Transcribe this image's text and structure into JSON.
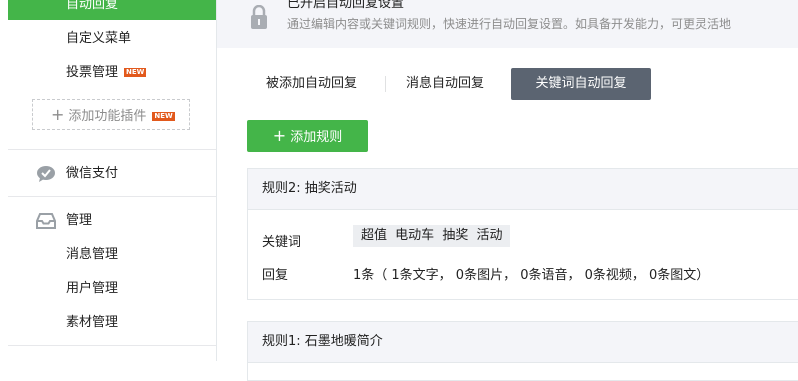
{
  "sidebar": {
    "active_item": "自动回复",
    "items": [
      {
        "label": "自定义菜单"
      },
      {
        "label": "投票管理",
        "badge": "NEW"
      }
    ],
    "add_plugin": {
      "label": "添加功能插件",
      "badge": "NEW"
    },
    "categories": [
      {
        "label": "微信支付",
        "icon": "wechat-pay-icon"
      },
      {
        "label": "管理",
        "icon": "inbox-icon",
        "children": [
          "消息管理",
          "用户管理",
          "素材管理"
        ]
      }
    ]
  },
  "notice": {
    "title": "已开启自动回复设置",
    "description": "通过编辑内容或关键词规则，快速进行自动回复设置。如具备开发能力，可更灵活地",
    "icon": "lock-icon"
  },
  "tabs": [
    {
      "label": "被添加自动回复",
      "active": false
    },
    {
      "label": "消息自动回复",
      "active": false
    },
    {
      "label": "关键词自动回复",
      "active": true
    }
  ],
  "add_rule_button": {
    "label": "添加规则"
  },
  "rules": [
    {
      "title": "规则2: 抽奖活动",
      "keyword_label": "关键词",
      "keywords": [
        "超值",
        "电动车",
        "抽奖",
        "活动"
      ],
      "reply_label": "回复",
      "reply_summary": "1条（ 1条文字， 0条图片， 0条语音， 0条视频， 0条图文）"
    },
    {
      "title": "规则1: 石墨地暖简介"
    }
  ],
  "colors": {
    "accent_green": "#44b549",
    "active_tab": "#5b6471",
    "new_badge": "#e2591c"
  }
}
